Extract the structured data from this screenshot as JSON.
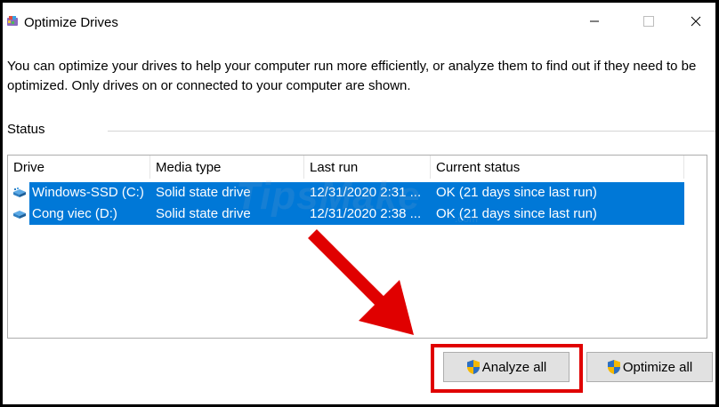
{
  "window": {
    "title": "Optimize Drives",
    "description": "You can optimize your drives to help your computer run more efficiently, or analyze them to find out if they need to be optimized. Only drives on or connected to your computer are shown.",
    "status_label": "Status"
  },
  "drive_list": {
    "columns": [
      "Drive",
      "Media type",
      "Last run",
      "Current status"
    ],
    "rows": [
      {
        "drive": "Windows-SSD (C:)",
        "media_type": "Solid state drive",
        "last_run": "12/31/2020 2:31 ...",
        "current_status": "OK (21 days since last run)",
        "icon": "drive-icon",
        "selected": true
      },
      {
        "drive": "Cong viec (D:)",
        "media_type": "Solid state drive",
        "last_run": "12/31/2020 2:38 ...",
        "current_status": "OK (21 days since last run)",
        "icon": "drive-icon",
        "selected": true
      }
    ]
  },
  "buttons": {
    "analyze_all": "Analyze all",
    "optimize_all": "Optimize all",
    "icon": "uac-shield-icon"
  },
  "watermark": {
    "text": "TipsMake",
    "suffix": ".com"
  },
  "colors": {
    "selection": "#0078d7",
    "highlight": "#e00000",
    "arrow": "#e00000"
  }
}
